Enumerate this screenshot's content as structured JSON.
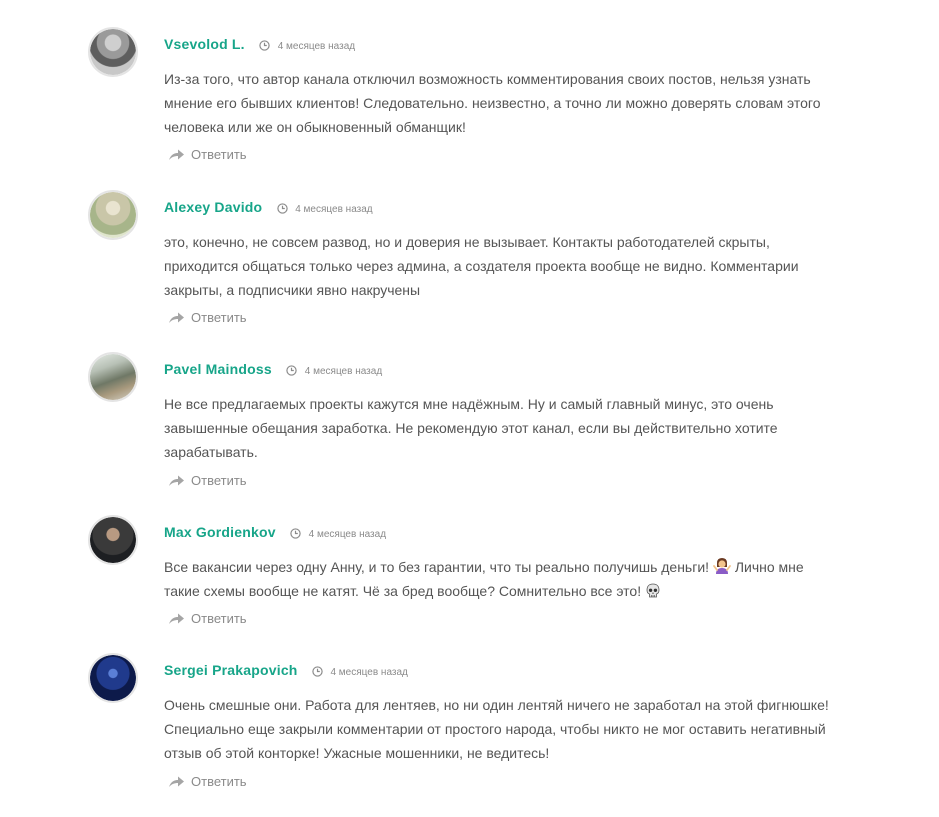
{
  "reply_label": "Ответить",
  "colors": {
    "author": "#17a589",
    "text": "#555555",
    "meta": "#8a8a8a"
  },
  "icons": {
    "time": "clock-icon",
    "reply": "reply-arrow-icon"
  },
  "comments": [
    {
      "author": "Vsevolod L.",
      "time": "4 месяцев назад",
      "text": "Из-за того, что автор канала отключил возможность комментирования своих постов, нельзя узнать мнение его бывших клиентов! Следовательно. неизвестно, а точно ли можно доверять словам этого человека или же он обыкновенный обманщик!"
    },
    {
      "author": "Alexey Davido",
      "time": "4 месяцев назад",
      "text": "это, конечно, не совсем развод, но и доверия не вызывает. Контакты работодателей скрыты, приходится общаться только через админа, а создателя проекта вообще не видно. Комментарии закрыты, а подписчики явно накручены"
    },
    {
      "author": "Pavel Maindoss",
      "time": "4 месяцев назад",
      "text": "Не все предлагаемых проекты кажутся мне надёжным. Ну и самый главный минус, это очень завышенные обещания заработка. Не рекомендую этот канал, если вы действительно хотите зарабатывать."
    },
    {
      "author": "Max Gordienkov",
      "time": "4 месяцев назад",
      "text_part1": "Все вакансии через одну Анну, и то без гарантии, что ты реально получишь деньги!",
      "text_part2": "Лично мне такие схемы вообще не катят. Чё за бред вообще? Сомнительно все это!",
      "emoji_1": "woman-shrugging-emoji",
      "emoji_2": "skull-emoji"
    },
    {
      "author": "Sergei Prakapovich",
      "time": "4 месяцев назад",
      "text": "Очень смешные они. Работа для лентяев, но ни один лентяй ничего не заработал на этой фигнюшке! Специально еще закрыли комментарии от простого народа, чтобы никто не мог оставить негативный отзыв об этой конторке! Ужасные мошенники, не ведитесь!"
    }
  ]
}
